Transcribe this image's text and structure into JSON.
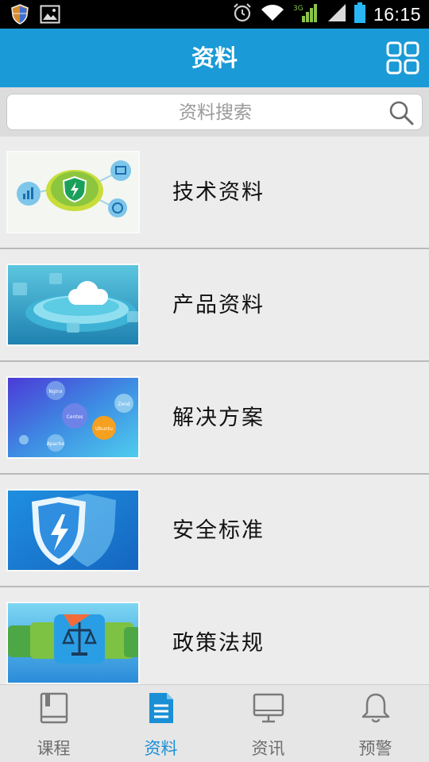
{
  "status_bar": {
    "time": "16:15",
    "network": "3G"
  },
  "header": {
    "title": "资料"
  },
  "search": {
    "placeholder": "资料搜索"
  },
  "list": {
    "items": [
      {
        "label": "技术资料"
      },
      {
        "label": "产品资料"
      },
      {
        "label": "解决方案",
        "thumb_tags": [
          "Nginx",
          "Centos",
          "Zend",
          "Ubuntu",
          "Apache"
        ]
      },
      {
        "label": "安全标准"
      },
      {
        "label": "政策法规"
      }
    ]
  },
  "bottom_nav": {
    "items": [
      {
        "label": "课程",
        "icon": "book-icon",
        "active": false
      },
      {
        "label": "资料",
        "icon": "document-icon",
        "active": true
      },
      {
        "label": "资讯",
        "icon": "monitor-icon",
        "active": false
      },
      {
        "label": "预警",
        "icon": "bell-icon",
        "active": false
      }
    ]
  },
  "colors": {
    "accent": "#1a9ad6",
    "active_tab": "#1a8fd6",
    "inactive_tab": "#6e6e6e"
  }
}
